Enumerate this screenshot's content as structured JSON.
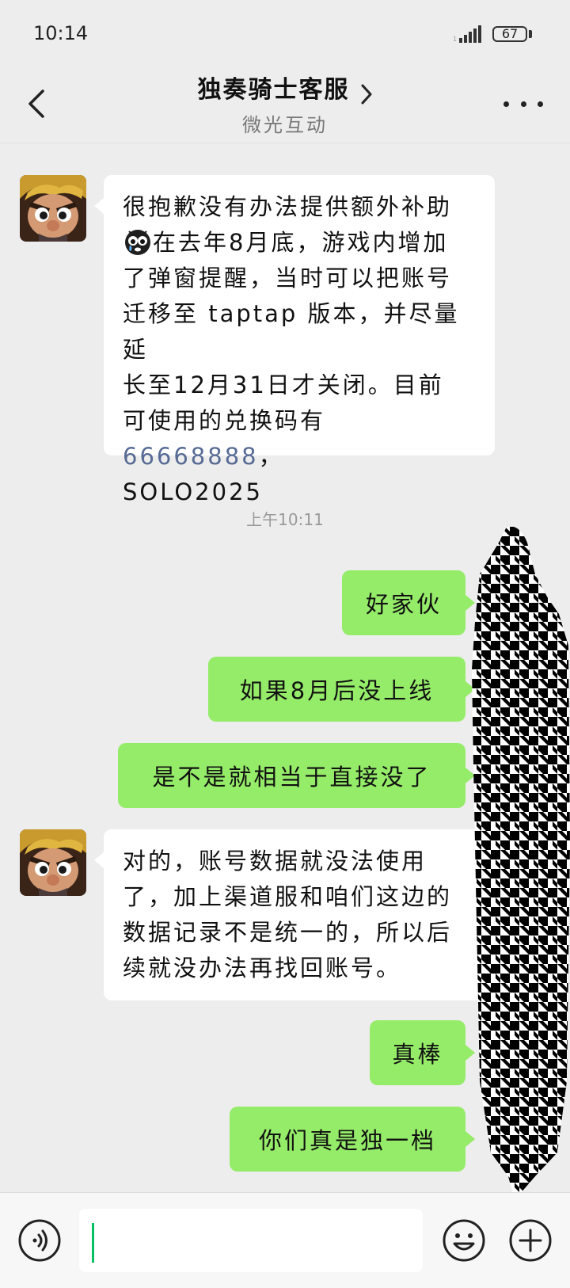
{
  "status": {
    "time": "10:14",
    "battery": "67"
  },
  "header": {
    "title": "独奏骑士客服",
    "subtitle": "微光互动"
  },
  "messages": {
    "m1": {
      "sender": "service",
      "text_lines": [
        "很抱歉没有办法提供额外补助",
        "在去年8月底，游戏内增加",
        "了弹窗提醒，当时可以把账号",
        "迁移至 taptap 版本，并尽量延",
        "长至12月31日才关闭。目前",
        "可使用的兑换码有 ",
        "，",
        "SOLO2025"
      ],
      "code": "66668888",
      "emoji": "crying-face-emoji"
    },
    "timestamp": "上午10:11",
    "m2": {
      "sender": "me",
      "text": "好家伙"
    },
    "m3": {
      "sender": "me",
      "text": "如果8月后没上线"
    },
    "m4": {
      "sender": "me",
      "text": "是不是就相当于直接没了"
    },
    "m5": {
      "sender": "service",
      "text_lines": [
        "对的，账号数据就没法使用",
        "了，加上渠道服和咱们这边的",
        "数据记录不是统一的，所以后",
        "续就没办法再找回账号。"
      ]
    },
    "m6": {
      "sender": "me",
      "text": "真棒"
    },
    "m7": {
      "sender": "me",
      "text": "你们真是独一档"
    }
  },
  "input": {
    "value": "",
    "placeholder": ""
  },
  "icons": {
    "back": "chevron-left-icon",
    "title_arrow": "chevron-right-icon",
    "more": "more-dots-icon",
    "voice": "voice-icon",
    "emoji": "emoji-icon",
    "plus": "plus-icon"
  },
  "colors": {
    "outgoing_bubble": "#95ec69",
    "incoming_bubble": "#ffffff",
    "background": "#ededed",
    "link": "#576b95",
    "caret": "#07c160"
  }
}
